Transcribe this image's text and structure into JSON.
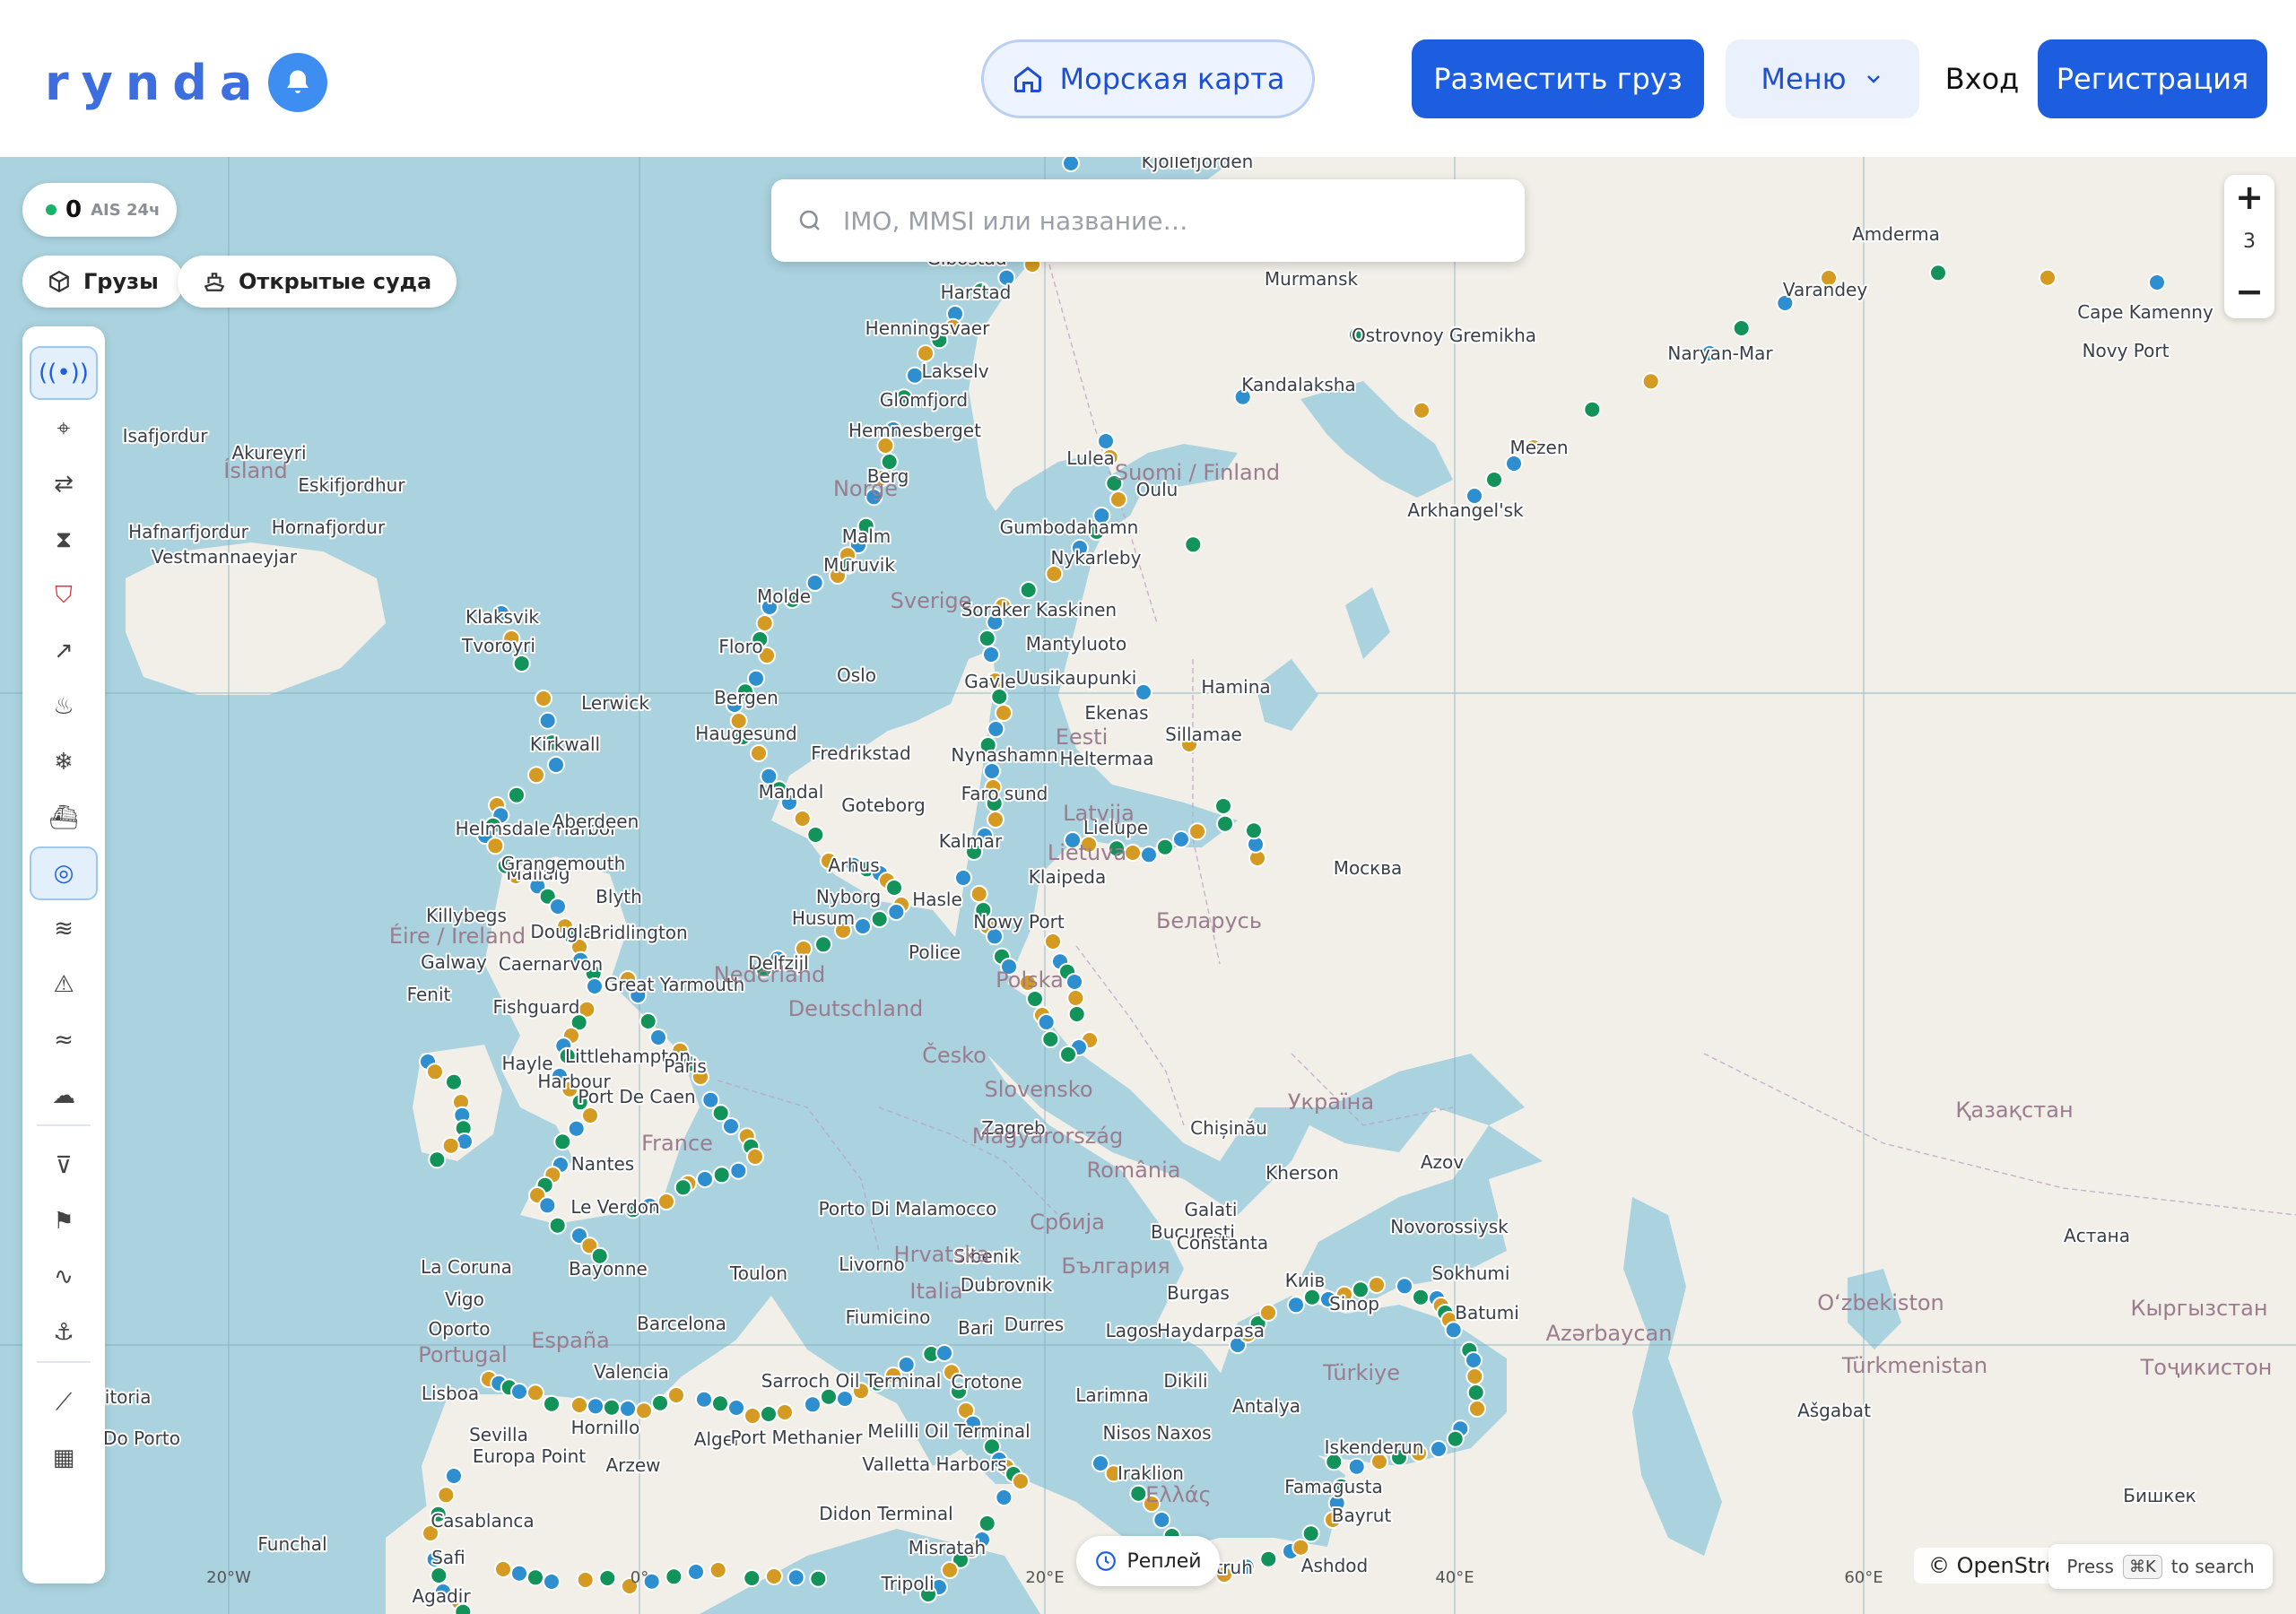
{
  "header": {
    "logo_text": "rynda",
    "nav_map_label": "Морская карта",
    "post_cargo_label": "Разместить груз",
    "menu_label": "Меню",
    "login_label": "Вход",
    "register_label": "Регистрация"
  },
  "ais": {
    "count": "0",
    "label": "AIS 24ч",
    "status_color": "#18b36b"
  },
  "chips": {
    "cargo": "Грузы",
    "open_vessels": "Открытые суда"
  },
  "search": {
    "placeholder": "IMO, MMSI или название…"
  },
  "toolbar": {
    "items": [
      {
        "icon": "ais-signal-icon",
        "active": true
      },
      {
        "icon": "map-pin-icon",
        "active": false
      },
      {
        "icon": "route-icon",
        "active": false
      },
      {
        "icon": "hourglass-icon",
        "active": false
      },
      {
        "icon": "shield-alert-icon",
        "active": false
      },
      {
        "icon": "trend-icon",
        "active": false
      },
      {
        "icon": "flame-icon",
        "active": false
      },
      {
        "icon": "snowflake-icon",
        "active": false
      },
      {
        "icon": "ship-icon",
        "active": false
      },
      {
        "icon": "lifebuoy-icon",
        "active": true
      },
      {
        "icon": "waves-icon",
        "active": false
      },
      {
        "icon": "warning-icon",
        "active": false
      },
      {
        "icon": "wind-icon",
        "active": false
      },
      {
        "icon": "cloud-icon",
        "active": false
      },
      {
        "icon": "filter-icon",
        "active": false
      },
      {
        "icon": "flag-icon",
        "active": false
      },
      {
        "icon": "pulse-icon",
        "active": false
      },
      {
        "icon": "anchor-icon",
        "active": false
      },
      {
        "icon": "ruler-icon",
        "active": false
      },
      {
        "icon": "grid-icon",
        "active": false
      }
    ]
  },
  "zoom": {
    "level": "3",
    "plus": "+",
    "minus": "−"
  },
  "replay_label": "Реплей",
  "attribution": "© OpenStreetMap",
  "kbd_hint": {
    "press": "Press",
    "key": "⌘K",
    "suffix": "to search"
  },
  "map": {
    "colors": {
      "water": "#aad3df",
      "land": "#f2efe9",
      "port_blue": "#2e8fd0",
      "port_orange": "#d59a22",
      "port_green": "#12935a"
    },
    "grid_labels": [
      "20°W",
      "0°",
      "20°E",
      "40°E",
      "60°E"
    ],
    "country_labels": [
      "Suomi / Finland",
      "Sverige",
      "Norge",
      "Eesti",
      "Latvija",
      "Lietuva",
      "Беларусь",
      "Polska",
      "Deutschland",
      "Nederland",
      "Éire / Ireland",
      "France",
      "España",
      "Portugal",
      "Česko",
      "Slovensko",
      "Magyarország",
      "România",
      "Србија",
      "България",
      "Україна",
      "Türkiye",
      "Қазақстан",
      "Azərbaycan",
      "Türkmenistan",
      "Oʻzbekiston",
      "Кыргызстан",
      "Тоҷикистон",
      "Ísland",
      "Italia",
      "Hrvatska",
      "Ελλάς"
    ],
    "city_labels": [
      "Москва",
      "Киів",
      "Астана",
      "Бишкек",
      "Ašgabat",
      "Chișinău",
      "Kjollefjorden",
      "Gibostad",
      "Harstad",
      "Henningsvaer",
      "Lakselv",
      "Glomfjord",
      "Hemnesberget",
      "Berg",
      "Malm",
      "Muruvik",
      "Molde",
      "Floro",
      "Bergen",
      "Haugesund",
      "Mandal",
      "Oslo",
      "Fredrikstad",
      "Goteborg",
      "Kalmar",
      "Arhus",
      "Nyborg",
      "Hasle",
      "Husum",
      "Nowy Port",
      "Police",
      "Delfzijl",
      "Klaipeda",
      "Lielupe",
      "Faro sund",
      "Nynashamn",
      "Heltermaa",
      "Ekenas",
      "Sillamae",
      "Hamina",
      "Uusikaupunki",
      "Mantyluoto",
      "Kaskinen",
      "Soraker",
      "Gavle",
      "Nykarleby",
      "Gumbodahamn",
      "Oulu",
      "Lulea",
      "Murmansk",
      "Kandalaksha",
      "Ostrovnoy Gremikha",
      "Mezen",
      "Arkhangel'sk",
      "Naryan-Mar",
      "Amderma",
      "Varandey",
      "Cape Kamenny",
      "Novy Port",
      "Isafjordur",
      "Akureyri",
      "Eskifjordhur",
      "Hornafjordur",
      "Hafnarfjordur",
      "Vestmannaeyjar",
      "Klaksvik",
      "Tvoroyri",
      "Lerwick",
      "Kirkwall",
      "Helmsdale Harbor",
      "Mallaig",
      "Aberdeen",
      "Grangemouth",
      "Blyth",
      "Killybegs",
      "Douglas",
      "Bridlington",
      "Galway",
      "Caernarvon",
      "Fenit",
      "Fishguard",
      "Great Yarmouth",
      "Littlehampton",
      "Harbour",
      "Hayle",
      "Paris",
      "Port De Caen",
      "Nantes",
      "Le Verdon",
      "La Coruna",
      "Vigo",
      "Oporto",
      "Lisboa",
      "Vitoria",
      "Do Porto",
      "Bayonne",
      "Barcelona",
      "Valencia",
      "Sevilla",
      "Hornillo",
      "Europa Point",
      "Arzew",
      "Alger",
      "Port Methanier",
      "Casablanca",
      "Safi",
      "Agadir",
      "Funchal",
      "Toulon",
      "Livorno",
      "Fiumicino",
      "Porto Di Malamocco",
      "Zagreb",
      "Sibenik",
      "Dubrovnik",
      "Bari",
      "Durres",
      "Crotone",
      "Sarroch Oil Terminal",
      "Melilli Oil Terminal",
      "Valletta Harbors",
      "Didon Terminal",
      "Misratah",
      "Tripoli",
      "Galati",
      "Bucuresti",
      "Constanta",
      "Burgas",
      "Haydarpasa",
      "Lagos",
      "Dikili",
      "Larimna",
      "Nisos Naxos",
      "Iraklion",
      "Antalya",
      "Iskenderun",
      "Famagusta",
      "Bayrut",
      "Ashdod",
      "Kherson",
      "Azov",
      "Novorossiysk",
      "Sokhumi",
      "Batumi",
      "Sinop",
      "Mersa Matruh"
    ]
  }
}
